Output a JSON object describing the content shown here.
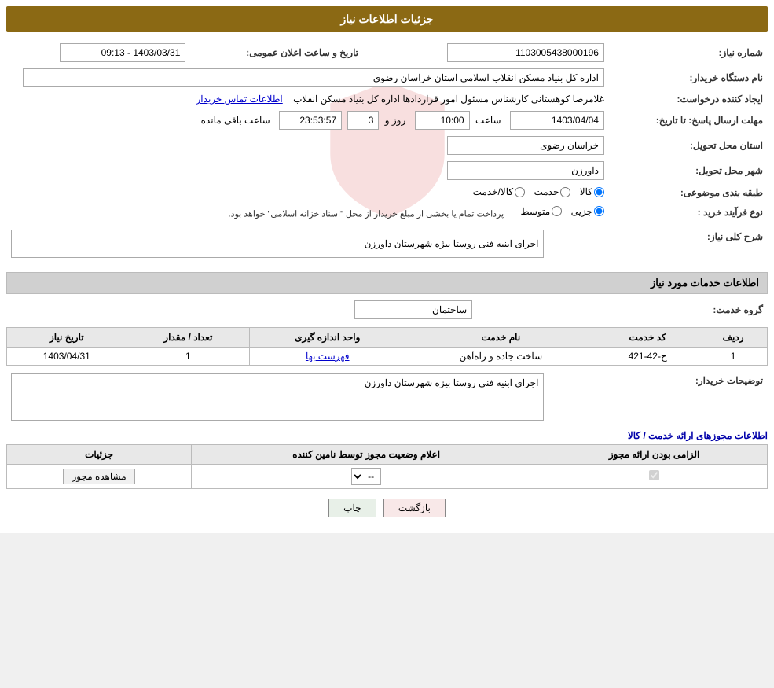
{
  "page": {
    "title": "جزئیات اطلاعات نیاز"
  },
  "header": {
    "need_number_label": "شماره نیاز:",
    "need_number_value": "1103005438000196",
    "announce_date_label": "تاریخ و ساعت اعلان عمومی:",
    "announce_date_value": "1403/03/31 - 09:13",
    "buyer_org_label": "نام دستگاه خریدار:",
    "buyer_org_value": "اداره کل بنیاد مسکن انقلاب اسلامی استان خراسان رضوی",
    "requester_label": "ایجاد کننده درخواست:",
    "requester_value": "غلامرضا کوهستانی کارشناس مسئول امور قراردادها اداره کل بنیاد مسکن انقلاب",
    "contact_link": "اطلاعات تماس خریدار",
    "deadline_label": "مهلت ارسال پاسخ: تا تاریخ:",
    "deadline_date": "1403/04/04",
    "deadline_time_label": "ساعت",
    "deadline_time_value": "10:00",
    "deadline_day_label": "روز و",
    "deadline_day_value": "3",
    "deadline_remaining_label": "ساعت باقی مانده",
    "deadline_remaining_value": "23:53:57",
    "province_label": "استان محل تحویل:",
    "province_value": "خراسان رضوی",
    "city_label": "شهر محل تحویل:",
    "city_value": "داورزن",
    "category_label": "طبقه بندی موضوعی:",
    "category_options": [
      "کالا",
      "خدمت",
      "کالا/خدمت"
    ],
    "category_selected": "کالا",
    "purchase_type_label": "نوع فرآیند خرید :",
    "purchase_type_options": [
      "جزیی",
      "متوسط"
    ],
    "purchase_type_selected": "جزیی",
    "purchase_type_note": "پرداخت تمام یا بخشی از مبلغ خریدار از محل \"اسناد خزانه اسلامی\" خواهد بود."
  },
  "need_description": {
    "section_title": "شرح کلی نیاز:",
    "value": "اجرای ابنیه فنی روستا بیژه شهرستان داورزن"
  },
  "services_section": {
    "section_title": "اطلاعات خدمات مورد نیاز",
    "service_group_label": "گروه خدمت:",
    "service_group_value": "ساختمان",
    "table_headers": [
      "ردیف",
      "کد خدمت",
      "نام خدمت",
      "واحد اندازه گیری",
      "تعداد / مقدار",
      "تاریخ نیاز"
    ],
    "rows": [
      {
        "row_num": "1",
        "service_code": "ج-42-421",
        "service_name": "ساخت جاده و راه‌آهن",
        "unit": "فهرست بها",
        "quantity": "1",
        "need_date": "1403/04/31"
      }
    ]
  },
  "buyer_notes": {
    "label": "توضیحات خریدار:",
    "value": "اجرای ابنیه فنی روستا بیژه شهرستان داورزن"
  },
  "licenses_section": {
    "title": "اطلاعات مجوزهای ارائه خدمت / کالا",
    "table_headers": [
      "الزامی بودن ارائه مجوز",
      "اعلام وضعیت مجوز توسط نامین کننده",
      "جزئیات"
    ],
    "rows": [
      {
        "required": true,
        "status_value": "--",
        "details_btn": "مشاهده مجوز"
      }
    ]
  },
  "buttons": {
    "print": "چاپ",
    "back": "بازگشت"
  }
}
